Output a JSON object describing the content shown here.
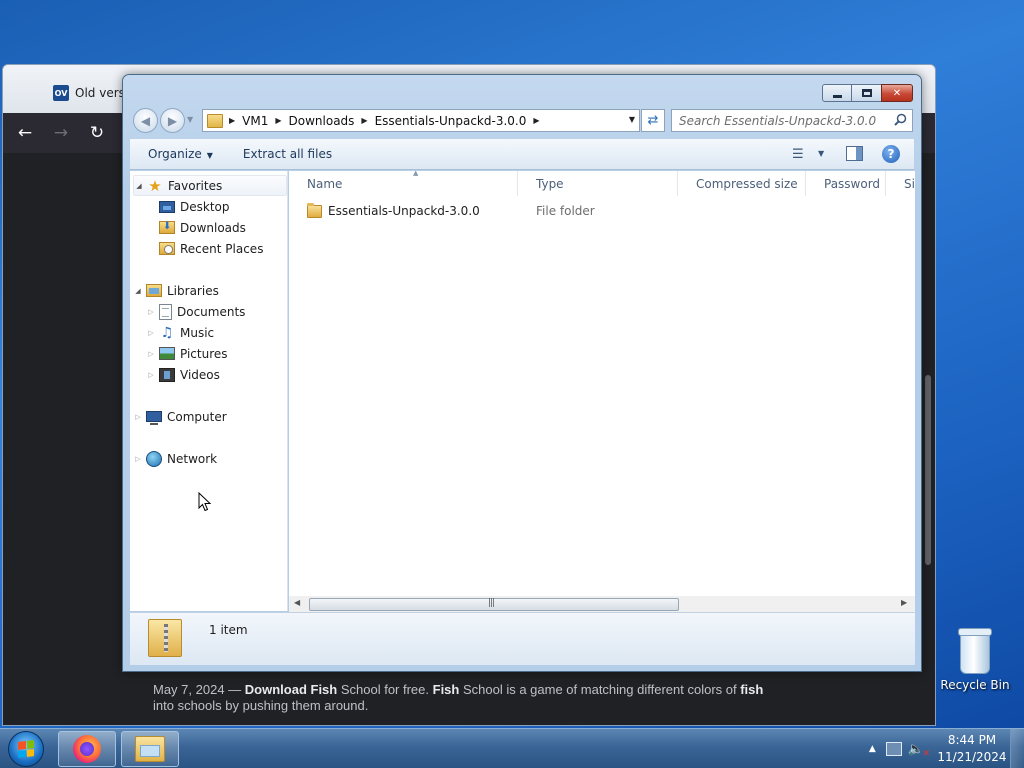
{
  "browser": {
    "tab_favicon_text": "OV",
    "tab_title": "Old vers",
    "back_icon": "arrow-left-icon",
    "forward_icon": "arrow-right-icon",
    "reload_icon": "reload-icon",
    "search_result": {
      "date": "May 7, 2024",
      "dash": " — ",
      "bold1": "Download Fish",
      "text1": " School for free. ",
      "bold2": "Fish",
      "text2": " School is a game of matching different colors of ",
      "bold3": "fish",
      "text3": " into schools by pushing them around."
    }
  },
  "explorer": {
    "title_buttons": {
      "minimize": "minimize-icon",
      "maximize": "maximize-icon",
      "close": "✕"
    },
    "breadcrumb": [
      "VM1",
      "Downloads",
      "Essentials-Unpackd-3.0.0"
    ],
    "search": {
      "placeholder": "Search Essentials-Unpackd-3.0.0"
    },
    "command_bar": {
      "organize": "Organize",
      "extract": "Extract all files",
      "help": "?"
    },
    "nav": {
      "favorites": "Favorites",
      "desktop": "Desktop",
      "downloads": "Downloads",
      "recent": "Recent Places",
      "libraries": "Libraries",
      "documents": "Documents",
      "music": "Music",
      "pictures": "Pictures",
      "videos": "Videos",
      "computer": "Computer",
      "network": "Network"
    },
    "columns": {
      "name": "Name",
      "type": "Type",
      "compressed_size": "Compressed size",
      "password": "Password ...",
      "size": "Si"
    },
    "files": [
      {
        "name": "Essentials-Unpackd-3.0.0",
        "type": "File folder"
      }
    ],
    "details": {
      "item_count": "1 item"
    }
  },
  "desktop": {
    "recycle_bin": "Recycle Bin"
  },
  "taskbar": {
    "time": "8:44 PM",
    "date": "11/21/2024"
  },
  "colors": {
    "taskbar": "#3b6596",
    "close_button": "#c74a36",
    "browser_toolbar": "#2b2a33",
    "browser_content": "#202124"
  }
}
